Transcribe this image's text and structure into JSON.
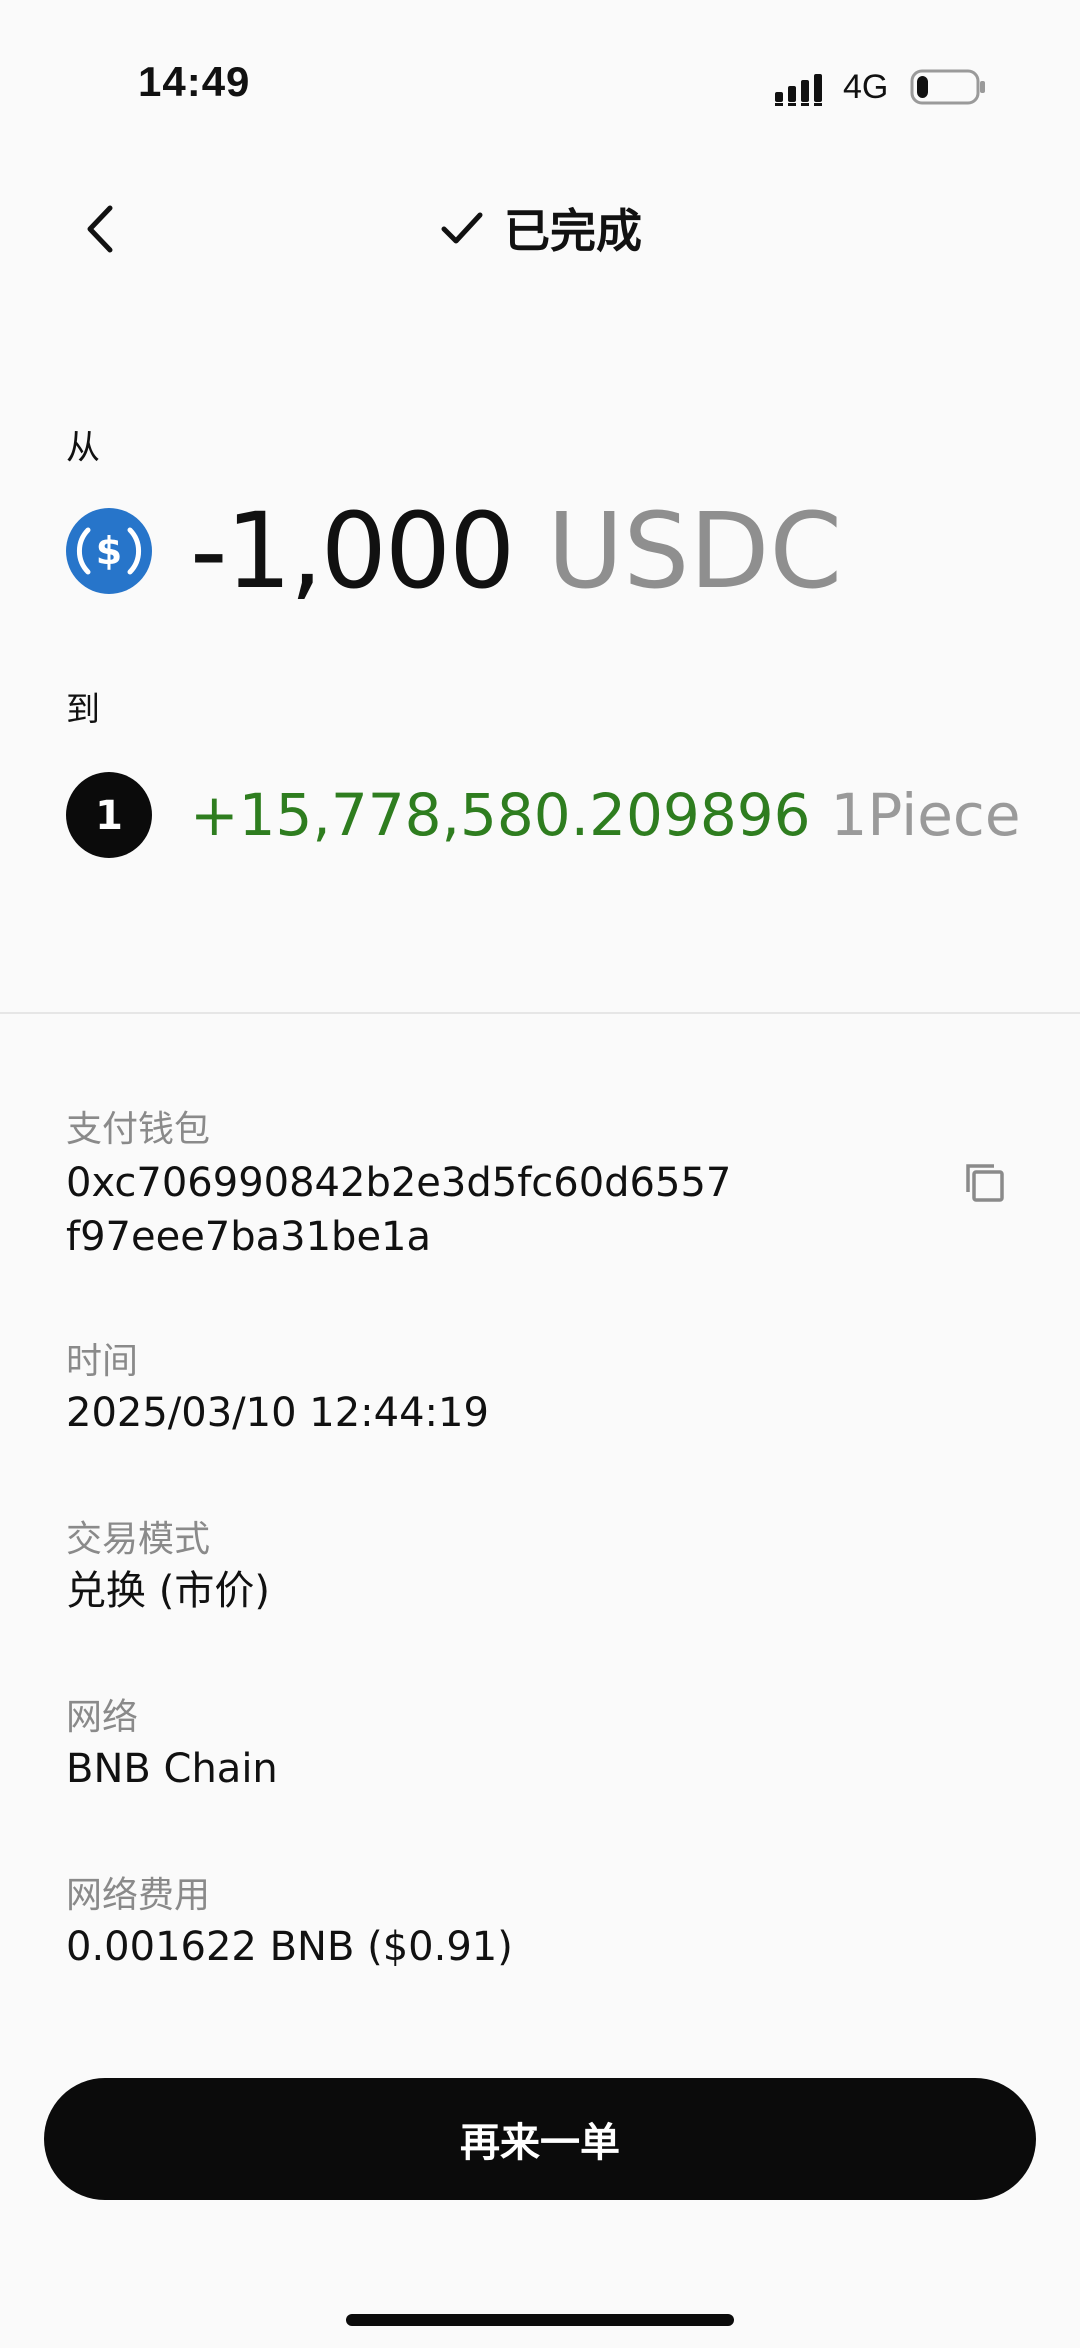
{
  "status_bar": {
    "time": "14:49",
    "network": "4G",
    "battery_level": 0.2
  },
  "header": {
    "title": "已完成"
  },
  "swap": {
    "from_label": "从",
    "from_amount": "-1,000",
    "from_symbol": "USDC",
    "from_icon": "usdc-token-icon",
    "to_label": "到",
    "to_amount": "+15,778,580.209896",
    "to_symbol": "1Piece",
    "to_icon_text": "1",
    "colors": {
      "positive": "#2e7d1f",
      "usdc_blue": "#2775ca"
    }
  },
  "details": {
    "wallet": {
      "label": "支付钱包",
      "value_line1": "0xc706990842b2e3d5fc60d6557",
      "value_line2": "f97eee7ba31be1a"
    },
    "time": {
      "label": "时间",
      "value": "2025/03/10 12:44:19"
    },
    "mode": {
      "label": "交易模式",
      "value": "兑换 (市价)"
    },
    "network": {
      "label": "网络",
      "value": "BNB Chain"
    },
    "fee": {
      "label": "网络费用",
      "value": "0.001622 BNB ($0.91)"
    }
  },
  "actions": {
    "repeat_label": "再来一单"
  }
}
